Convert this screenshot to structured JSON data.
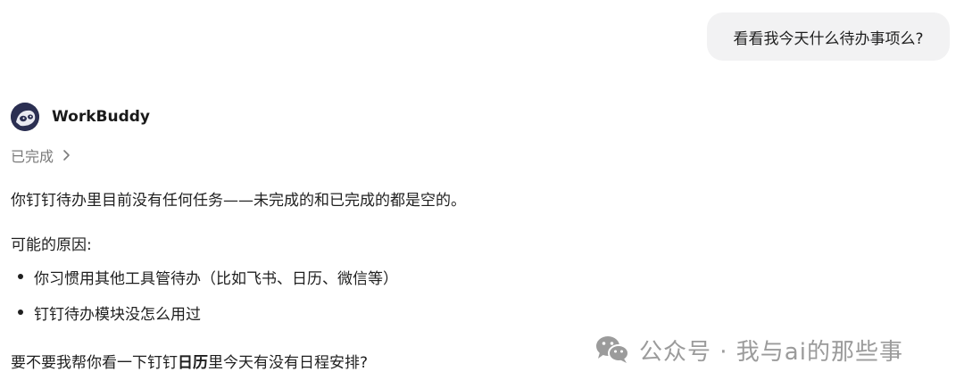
{
  "user_message": "看看我今天什么待办事项么?",
  "assistant": {
    "name": "WorkBuddy",
    "status_label": "已完成"
  },
  "reply": {
    "p1": "你钉钉待办里目前没有任何任务——未完成的和已完成的都是空的。",
    "reasons_title": "可能的原因:",
    "reasons": [
      "你习惯用其他工具管待办（比如飞书、日历、微信等）",
      "钉钉待办模块没怎么用过"
    ],
    "p3_before": "要不要我帮你看一下钉钉",
    "p3_bold": "日历",
    "p3_after": "里今天有没有日程安排?"
  },
  "watermark": "公众号 · 我与ai的那些事",
  "icons": {
    "avatar": "workbuddy-avatar-icon",
    "chevron": "chevron-right-icon",
    "wechat": "wechat-icon"
  },
  "colors": {
    "bubble_bg": "#f2f2f3",
    "muted_text": "#7a7a7a",
    "watermark": "#9b9b9b"
  }
}
